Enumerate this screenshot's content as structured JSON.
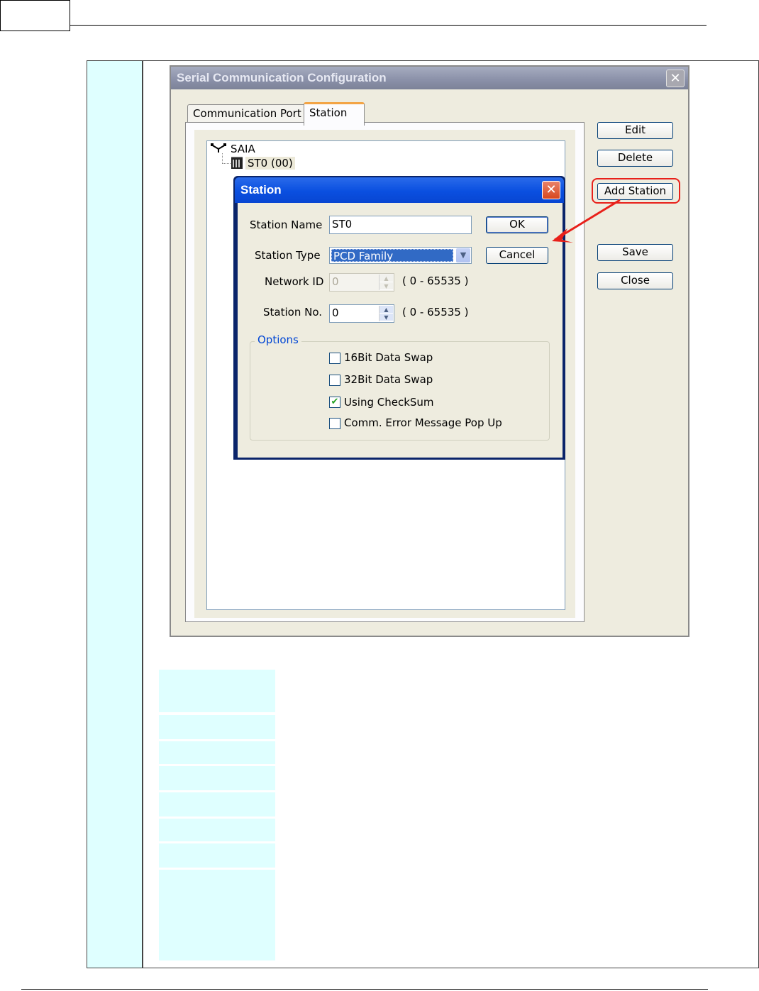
{
  "main_window": {
    "title": "Serial Communication Configuration",
    "close_glyph": "✕",
    "tabs": [
      {
        "label": "Communication Port",
        "active": false
      },
      {
        "label": "Station",
        "active": true
      }
    ],
    "tree": {
      "root": "SAIA",
      "children": [
        "ST0 (00)"
      ]
    },
    "buttons": {
      "edit": "Edit",
      "delete": "Delete",
      "add_station": "Add Station",
      "save": "Save",
      "close": "Close"
    }
  },
  "station_dialog": {
    "title": "Station",
    "close_glyph": "✕",
    "fields": {
      "station_name_label": "Station Name",
      "station_name_value": "ST0",
      "station_type_label": "Station Type",
      "station_type_value": "PCD Family",
      "network_id_label": "Network ID",
      "network_id_value": "0",
      "network_id_range": "( 0 - 65535 )",
      "station_no_label": "Station No.",
      "station_no_value": "0",
      "station_no_range": "( 0 - 65535 )"
    },
    "buttons": {
      "ok": "OK",
      "cancel": "Cancel"
    },
    "options": {
      "legend": "Options",
      "items": [
        {
          "label": "16Bit Data Swap",
          "checked": false
        },
        {
          "label": "32Bit Data Swap",
          "checked": false
        },
        {
          "label": "Using CheckSum",
          "checked": true
        },
        {
          "label": "Comm. Error Message Pop Up",
          "checked": false
        }
      ]
    }
  },
  "colors": {
    "highlight": "#e8201a",
    "side_column": "#dfffff",
    "dialog_title": "#0a4fe0"
  }
}
